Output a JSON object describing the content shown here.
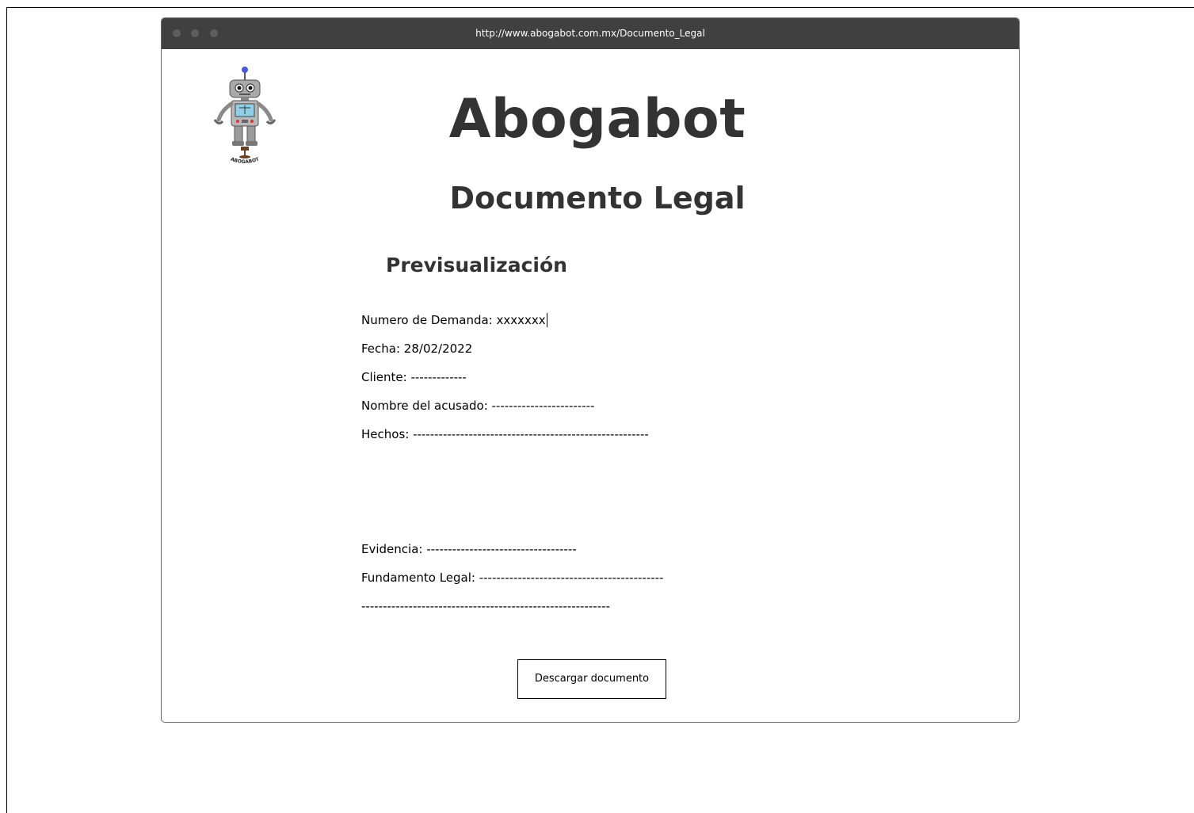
{
  "browser": {
    "url": "http://www.abogabot.com.mx/Documento_Legal"
  },
  "header": {
    "brand_title": "Abogabot",
    "page_title": "Documento Legal",
    "logo_caption": "ABOGABOT"
  },
  "preview": {
    "heading": "Previsualización",
    "fields": [
      {
        "label": "Numero de Demanda: xxxxxxx"
      },
      {
        "label": "Fecha: 28/02/2022"
      },
      {
        "label": "Cliente: -------------"
      },
      {
        "label": "Nombre del acusado: ------------------------"
      },
      {
        "label": "Hechos: -------------------------------------------------------"
      },
      {
        "label": "Evidencia: -----------------------------------"
      },
      {
        "label": "Fundamento Legal: -------------------------------------------"
      },
      {
        "label": "----------------------------------------------------------"
      }
    ]
  },
  "actions": {
    "download_label": "Descargar documento"
  }
}
